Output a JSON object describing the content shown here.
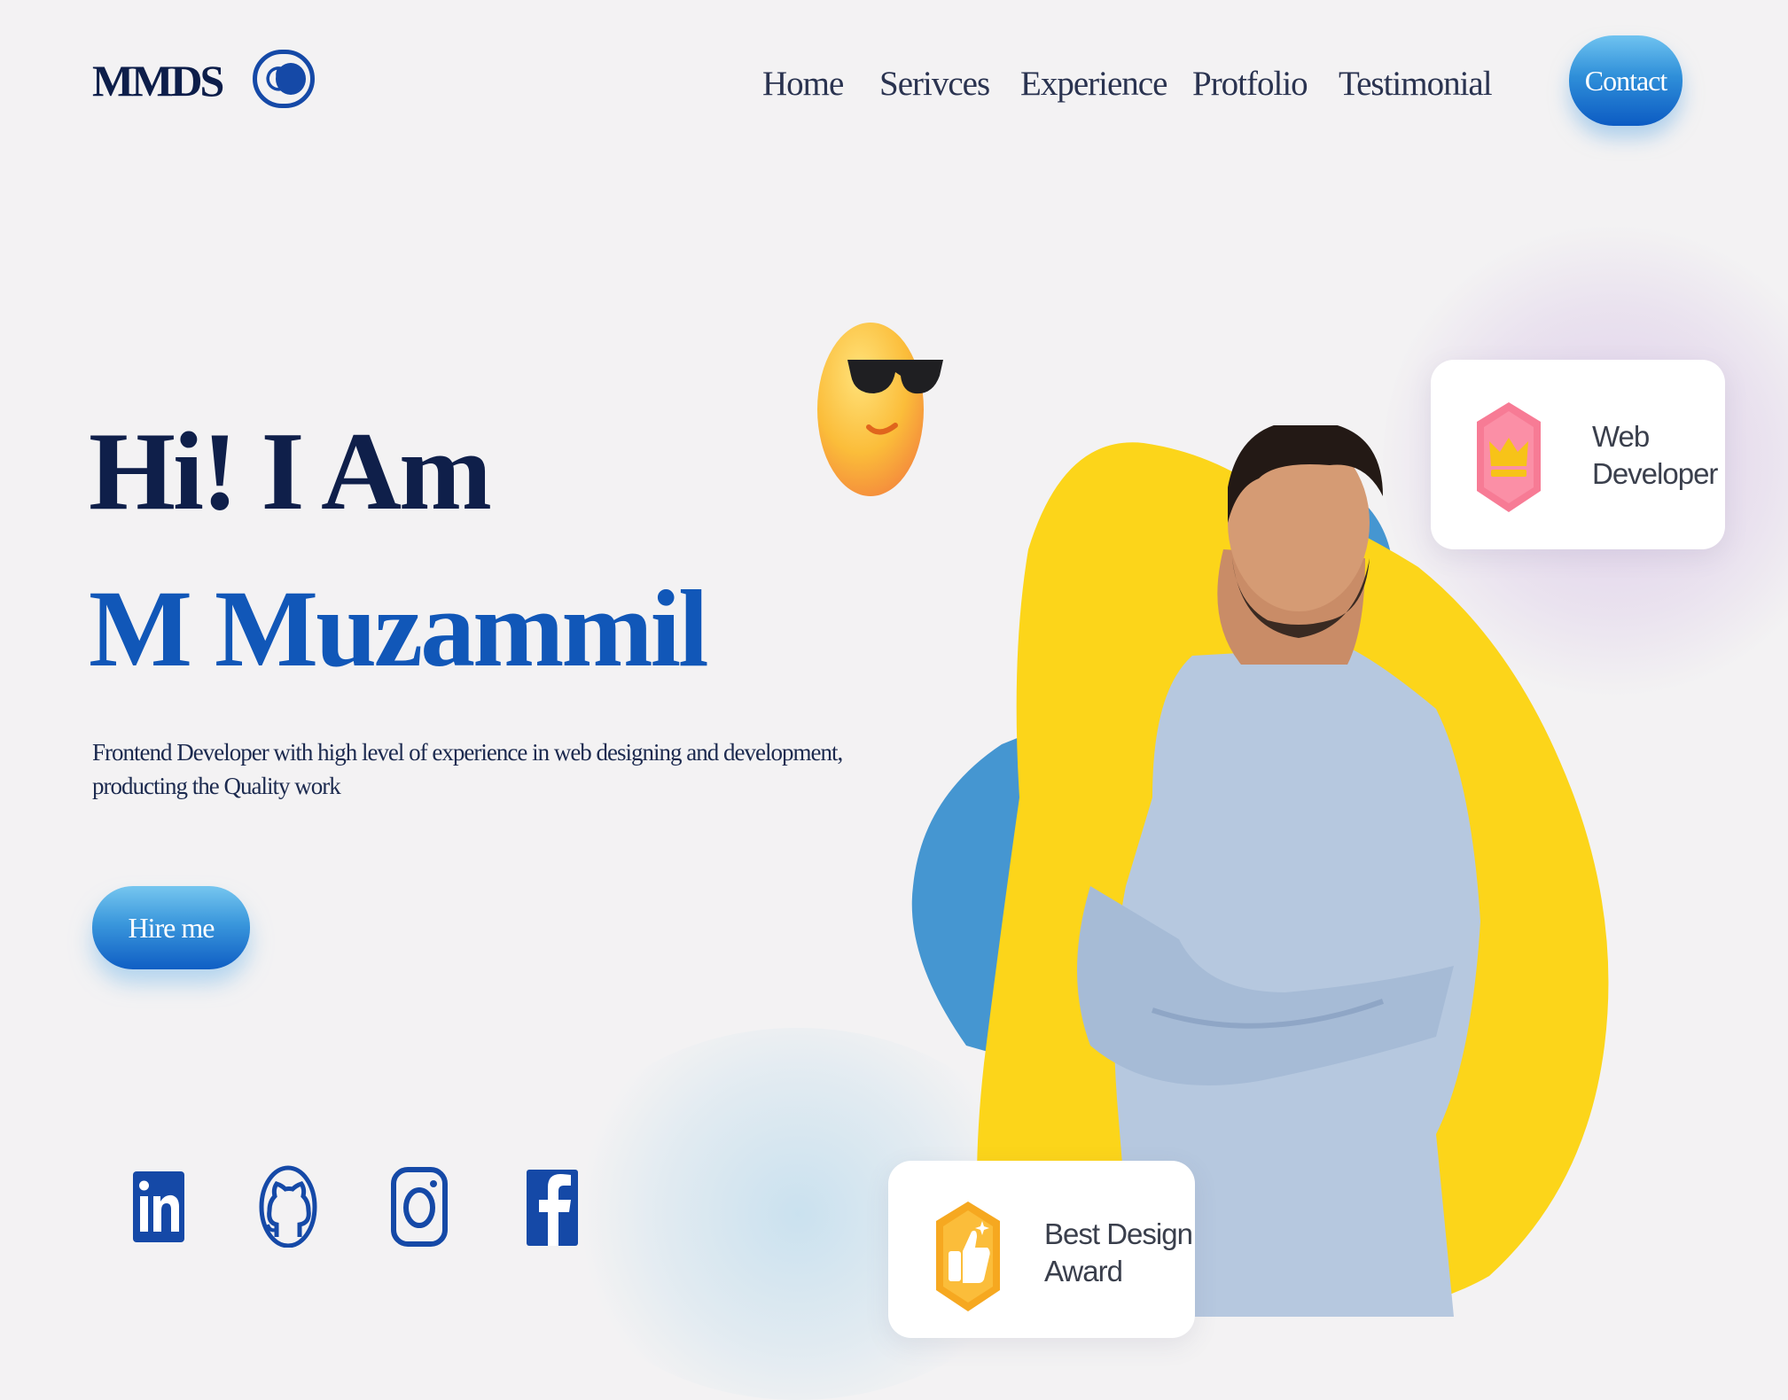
{
  "header": {
    "logo": "MMDS",
    "theme_toggle_icon": "moon-icon",
    "nav": [
      {
        "label": "Home"
      },
      {
        "label": "Serivces"
      },
      {
        "label": "Experience"
      },
      {
        "label": "Protfolio"
      },
      {
        "label": "Testimonial"
      }
    ],
    "contact_label": "Contact"
  },
  "hero": {
    "greeting": "Hi! I Am",
    "name": "M Muzammil",
    "description": "Frontend Developer with high level of experience in web designing and development, producting the Quality work",
    "hire_label": "Hire me",
    "emoji_icon": "sunglasses-emoji-icon"
  },
  "social": [
    {
      "icon": "linkedin-icon"
    },
    {
      "icon": "github-icon"
    },
    {
      "icon": "instagram-icon"
    },
    {
      "icon": "facebook-icon"
    }
  ],
  "badges": {
    "web_developer": {
      "line1": "Web",
      "line2": "Developer",
      "icon": "crown-icon"
    },
    "best_design": {
      "line1": "Best Design",
      "line2": "Award",
      "icon": "thumbs-up-icon"
    }
  },
  "colors": {
    "accent": "#1157b8",
    "dark_text": "#0f1f4a",
    "blob_yellow": "#fcd51a",
    "blob_blue": "#4596d1",
    "shirt": "#b6c8df"
  }
}
